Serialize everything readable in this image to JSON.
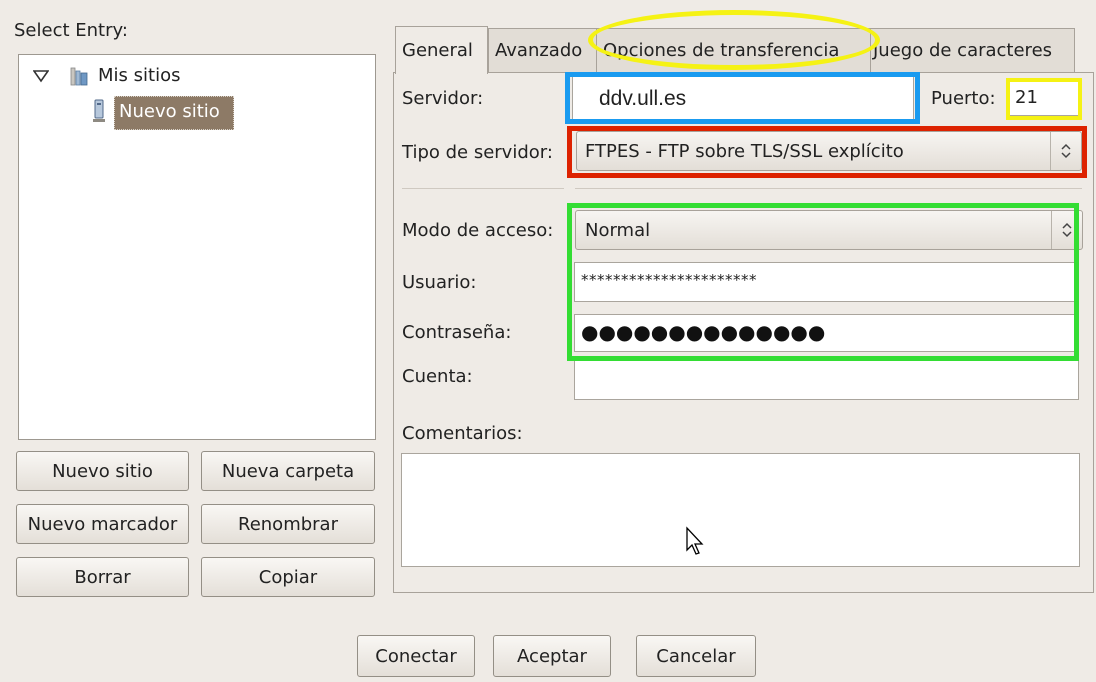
{
  "left": {
    "select_entry": "Select Entry:",
    "tree": {
      "root_label": "Mis sitios",
      "child_label": "Nuevo sitio"
    },
    "buttons": {
      "new_site": "Nuevo sitio",
      "new_folder": "Nueva carpeta",
      "new_bookmark": "Nuevo marcador",
      "rename": "Renombrar",
      "delete": "Borrar",
      "copy": "Copiar"
    }
  },
  "tabs": {
    "general": "General",
    "advanced": "Avanzado",
    "transfer": "Opciones de transferencia",
    "charset": "Juego de caracteres"
  },
  "form": {
    "server_label": "Servidor:",
    "server_value": "ddv.ull.es",
    "port_label": "Puerto:",
    "port_value": "21",
    "server_type_label": "Tipo de servidor:",
    "server_type_value": "FTPES - FTP sobre TLS/SSL explícito",
    "access_mode_label": "Modo de acceso:",
    "access_mode_value": "Normal",
    "user_label": "Usuario:",
    "user_value": "**********************",
    "password_label": "Contraseña:",
    "password_value": "●●●●●●●●●●●●●●",
    "account_label": "Cuenta:",
    "account_value": "",
    "comments_label": "Comentarios:",
    "comments_value": ""
  },
  "footer": {
    "connect": "Conectar",
    "accept": "Aceptar",
    "cancel": "Cancelar"
  },
  "highlight_colors": {
    "yellow": "#f5f214",
    "blue": "#1a9bf0",
    "red": "#dd2200",
    "green": "#33dd33"
  }
}
